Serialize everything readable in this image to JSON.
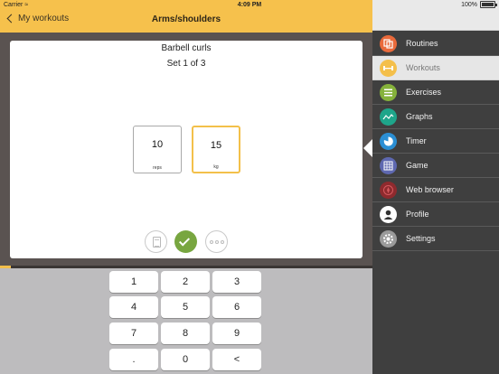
{
  "status_bar": {
    "carrier": "Carrier",
    "time": "4:09 PM",
    "battery": "100%"
  },
  "nav": {
    "back_label": "My workouts",
    "title": "Arms/shoulders"
  },
  "exercise": {
    "name": "Barbell curls",
    "set_label": "Set 1 of 3",
    "reps_value": "10",
    "reps_unit": "reps",
    "weight_value": "15",
    "weight_unit": "kg"
  },
  "progress": {
    "fraction": 0.03
  },
  "keypad": {
    "keys": [
      "1",
      "2",
      "3",
      "4",
      "5",
      "6",
      "7",
      "8",
      "9",
      ".",
      "0",
      "<"
    ]
  },
  "menu": {
    "items": [
      {
        "label": "Routines",
        "icon": "routines-icon",
        "color": "#ea6a3b"
      },
      {
        "label": "Workouts",
        "icon": "dumbbell-icon",
        "color": "#f4bf4a"
      },
      {
        "label": "Exercises",
        "icon": "list-icon",
        "color": "#86b23b"
      },
      {
        "label": "Graphs",
        "icon": "graph-icon",
        "color": "#1ea58a"
      },
      {
        "label": "Timer",
        "icon": "timer-icon",
        "color": "#2b8fd4"
      },
      {
        "label": "Game",
        "icon": "game-icon",
        "color": "#5e68b0"
      },
      {
        "label": "Web browser",
        "icon": "compass-icon",
        "color": "#8e2a2e"
      },
      {
        "label": "Profile",
        "icon": "profile-icon",
        "color": "#ffffff"
      },
      {
        "label": "Settings",
        "icon": "gear-icon",
        "color": "#9a9a9a"
      }
    ],
    "active_index": 1
  },
  "colors": {
    "accent": "#f6c14c",
    "done": "#78a640",
    "pane_bg": "#5a5351",
    "menu_bg": "#3f3f3f"
  }
}
